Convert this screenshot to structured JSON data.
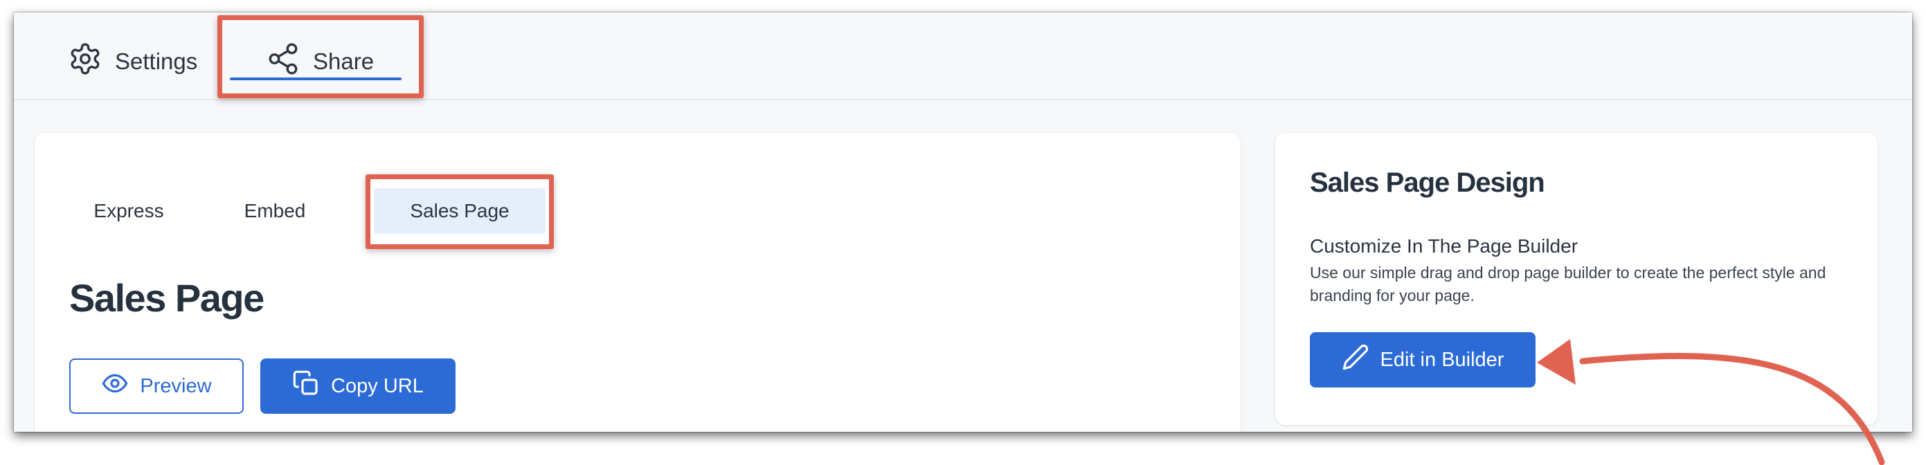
{
  "top_tabs": {
    "settings": "Settings",
    "share": "Share"
  },
  "sub_tabs": {
    "express": "Express",
    "embed": "Embed",
    "sales_page": "Sales Page"
  },
  "main": {
    "title": "Sales Page",
    "preview_label": "Preview",
    "copy_url_label": "Copy URL"
  },
  "design_panel": {
    "title": "Sales Page Design",
    "subtitle": "Customize In The Page Builder",
    "description": "Use our simple drag and drop page builder to create the perfect style and branding for your page.",
    "edit_label": "Edit in Builder"
  },
  "icons": {
    "settings": "gear-icon",
    "share": "share-icon",
    "preview": "eye-icon",
    "copy": "copy-icon",
    "edit": "pencil-icon"
  },
  "colors": {
    "accent": "#2c6bd6",
    "highlight": "#e06352",
    "active_tab_bg": "#e4effb"
  }
}
